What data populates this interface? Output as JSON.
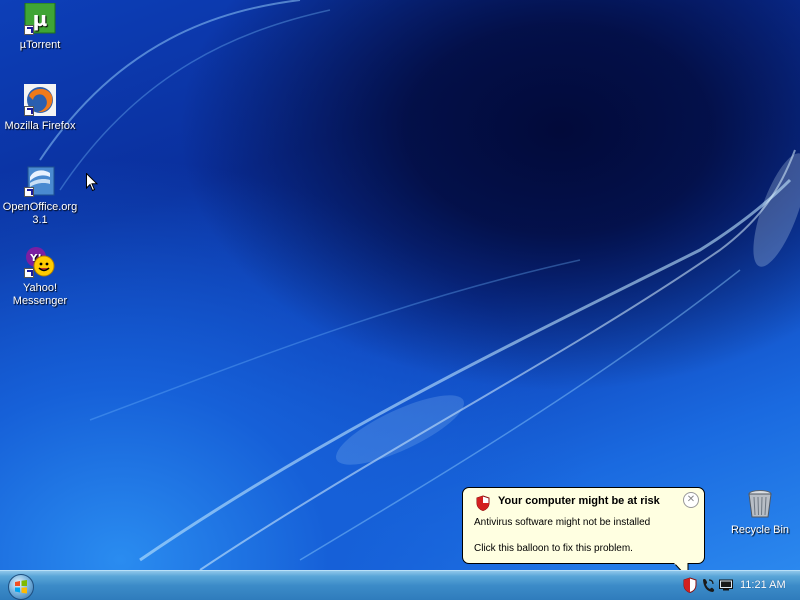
{
  "desktop": {
    "icons": [
      {
        "label": "µTorrent",
        "icon": "utorrent-icon"
      },
      {
        "label": "Mozilla Firefox",
        "icon": "firefox-icon"
      },
      {
        "label": "OpenOffice.org 3.1",
        "icon": "openoffice-icon"
      },
      {
        "label": "Yahoo! Messenger",
        "icon": "yahoo-messenger-icon"
      },
      {
        "label": "Recycle Bin",
        "icon": "recycle-bin-icon"
      }
    ]
  },
  "balloon": {
    "title": "Your computer might be at risk",
    "line1": "Antivirus software might not be installed",
    "line2": "Click this balloon to fix this problem.",
    "icon": "security-shield-icon",
    "close_icon": "close-icon"
  },
  "taskbar": {
    "start_icon": "windows-orb-icon",
    "tray_icons": [
      "security-shield-icon",
      "network-phone-icon",
      "display-icon"
    ],
    "clock": "11:21 AM"
  },
  "colors": {
    "balloon_bg": "#ffffe1",
    "taskbar": "#3c8bc8",
    "desktop": "#0c3cb4"
  }
}
